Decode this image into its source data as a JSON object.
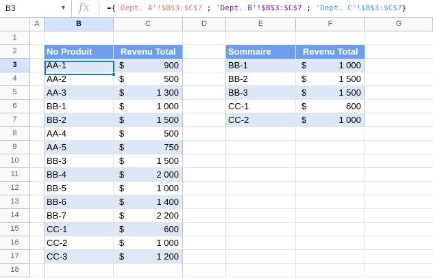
{
  "formula_bar": {
    "cell_ref": "B3",
    "dropdown_icon": "chevron-down-icon",
    "fx_label": "fx",
    "formula_prefix": "={",
    "sheet_ref_1": "'Dept. A'!$B$3:$C$7",
    "sep1": " ; ",
    "sheet_ref_2": "'Dept. B'!$B$3:$C$7",
    "sep2": " ; ",
    "sheet_ref_3": "'Dept. C'!$B$3:$C$7",
    "formula_suffix": "}"
  },
  "columns": [
    "A",
    "B",
    "C",
    "D",
    "E",
    "F",
    "G"
  ],
  "rows": [
    "1",
    "2",
    "3",
    "4",
    "5",
    "6",
    "7",
    "8",
    "9",
    "10",
    "11",
    "12",
    "13",
    "14",
    "15",
    "16",
    "17",
    "18"
  ],
  "selected": {
    "column": "B",
    "row": "3"
  },
  "colors": {
    "header_fill": "#6d9eeb",
    "band_fill": "#dce8f7",
    "selection": "#1a73e8"
  },
  "left_table": {
    "headers": [
      "No Produit",
      "Revenu Total"
    ],
    "rows": [
      {
        "id": "AA-1",
        "cur": "$",
        "val": "900"
      },
      {
        "id": "AA-2",
        "cur": "$",
        "val": "500"
      },
      {
        "id": "AA-3",
        "cur": "$",
        "val": "1 300"
      },
      {
        "id": "BB-1",
        "cur": "$",
        "val": "1 000"
      },
      {
        "id": "BB-2",
        "cur": "$",
        "val": "1 500"
      },
      {
        "id": "AA-4",
        "cur": "$",
        "val": "500"
      },
      {
        "id": "AA-5",
        "cur": "$",
        "val": "750"
      },
      {
        "id": "BB-3",
        "cur": "$",
        "val": "1 500"
      },
      {
        "id": "BB-4",
        "cur": "$",
        "val": "2 000"
      },
      {
        "id": "BB-5",
        "cur": "$",
        "val": "1 000"
      },
      {
        "id": "BB-6",
        "cur": "$",
        "val": "1 400"
      },
      {
        "id": "BB-7",
        "cur": "$",
        "val": "2 200"
      },
      {
        "id": "CC-1",
        "cur": "$",
        "val": "600"
      },
      {
        "id": "CC-2",
        "cur": "$",
        "val": "1 000"
      },
      {
        "id": "CC-3",
        "cur": "$",
        "val": "1 200"
      }
    ]
  },
  "right_table": {
    "headers": [
      "Sommaire",
      "Revenu Total"
    ],
    "rows": [
      {
        "id": "BB-1",
        "cur": "$",
        "val": "1 000"
      },
      {
        "id": "BB-2",
        "cur": "$",
        "val": "1 500"
      },
      {
        "id": "BB-3",
        "cur": "$",
        "val": "1 500"
      },
      {
        "id": "CC-1",
        "cur": "$",
        "val": "600"
      },
      {
        "id": "CC-2",
        "cur": "$",
        "val": "1 000"
      }
    ]
  }
}
